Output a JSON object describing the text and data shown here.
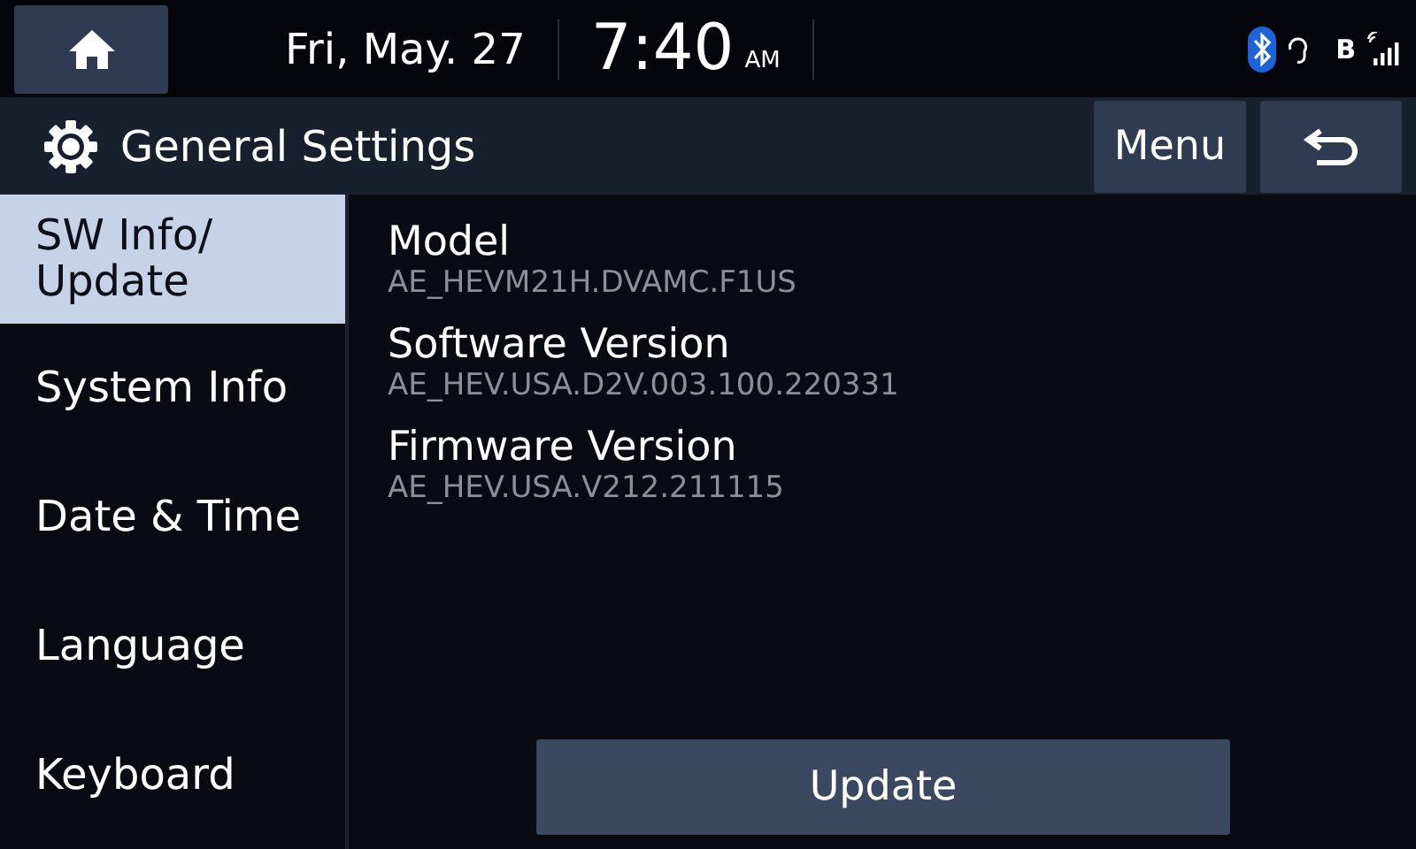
{
  "status_bar": {
    "date": "Fri, May. 27",
    "time": "7:40",
    "meridiem": "AM",
    "signal_text": "B"
  },
  "header": {
    "title": "General Settings",
    "menu_button": "Menu"
  },
  "sidebar": {
    "items": [
      {
        "label": "SW Info/\nUpdate",
        "selected": true
      },
      {
        "label": "System Info",
        "selected": false
      },
      {
        "label": "Date & Time",
        "selected": false
      },
      {
        "label": "Language",
        "selected": false
      },
      {
        "label": "Keyboard",
        "selected": false
      }
    ]
  },
  "info": [
    {
      "label": "Model",
      "value": "AE_HEVM21H.DVAMC.F1US"
    },
    {
      "label": "Software Version",
      "value": "AE_HEV.USA.D2V.003.100.220331"
    },
    {
      "label": "Firmware Version",
      "value": "AE_HEV.USA.V212.211115"
    }
  ],
  "update_button": "Update"
}
